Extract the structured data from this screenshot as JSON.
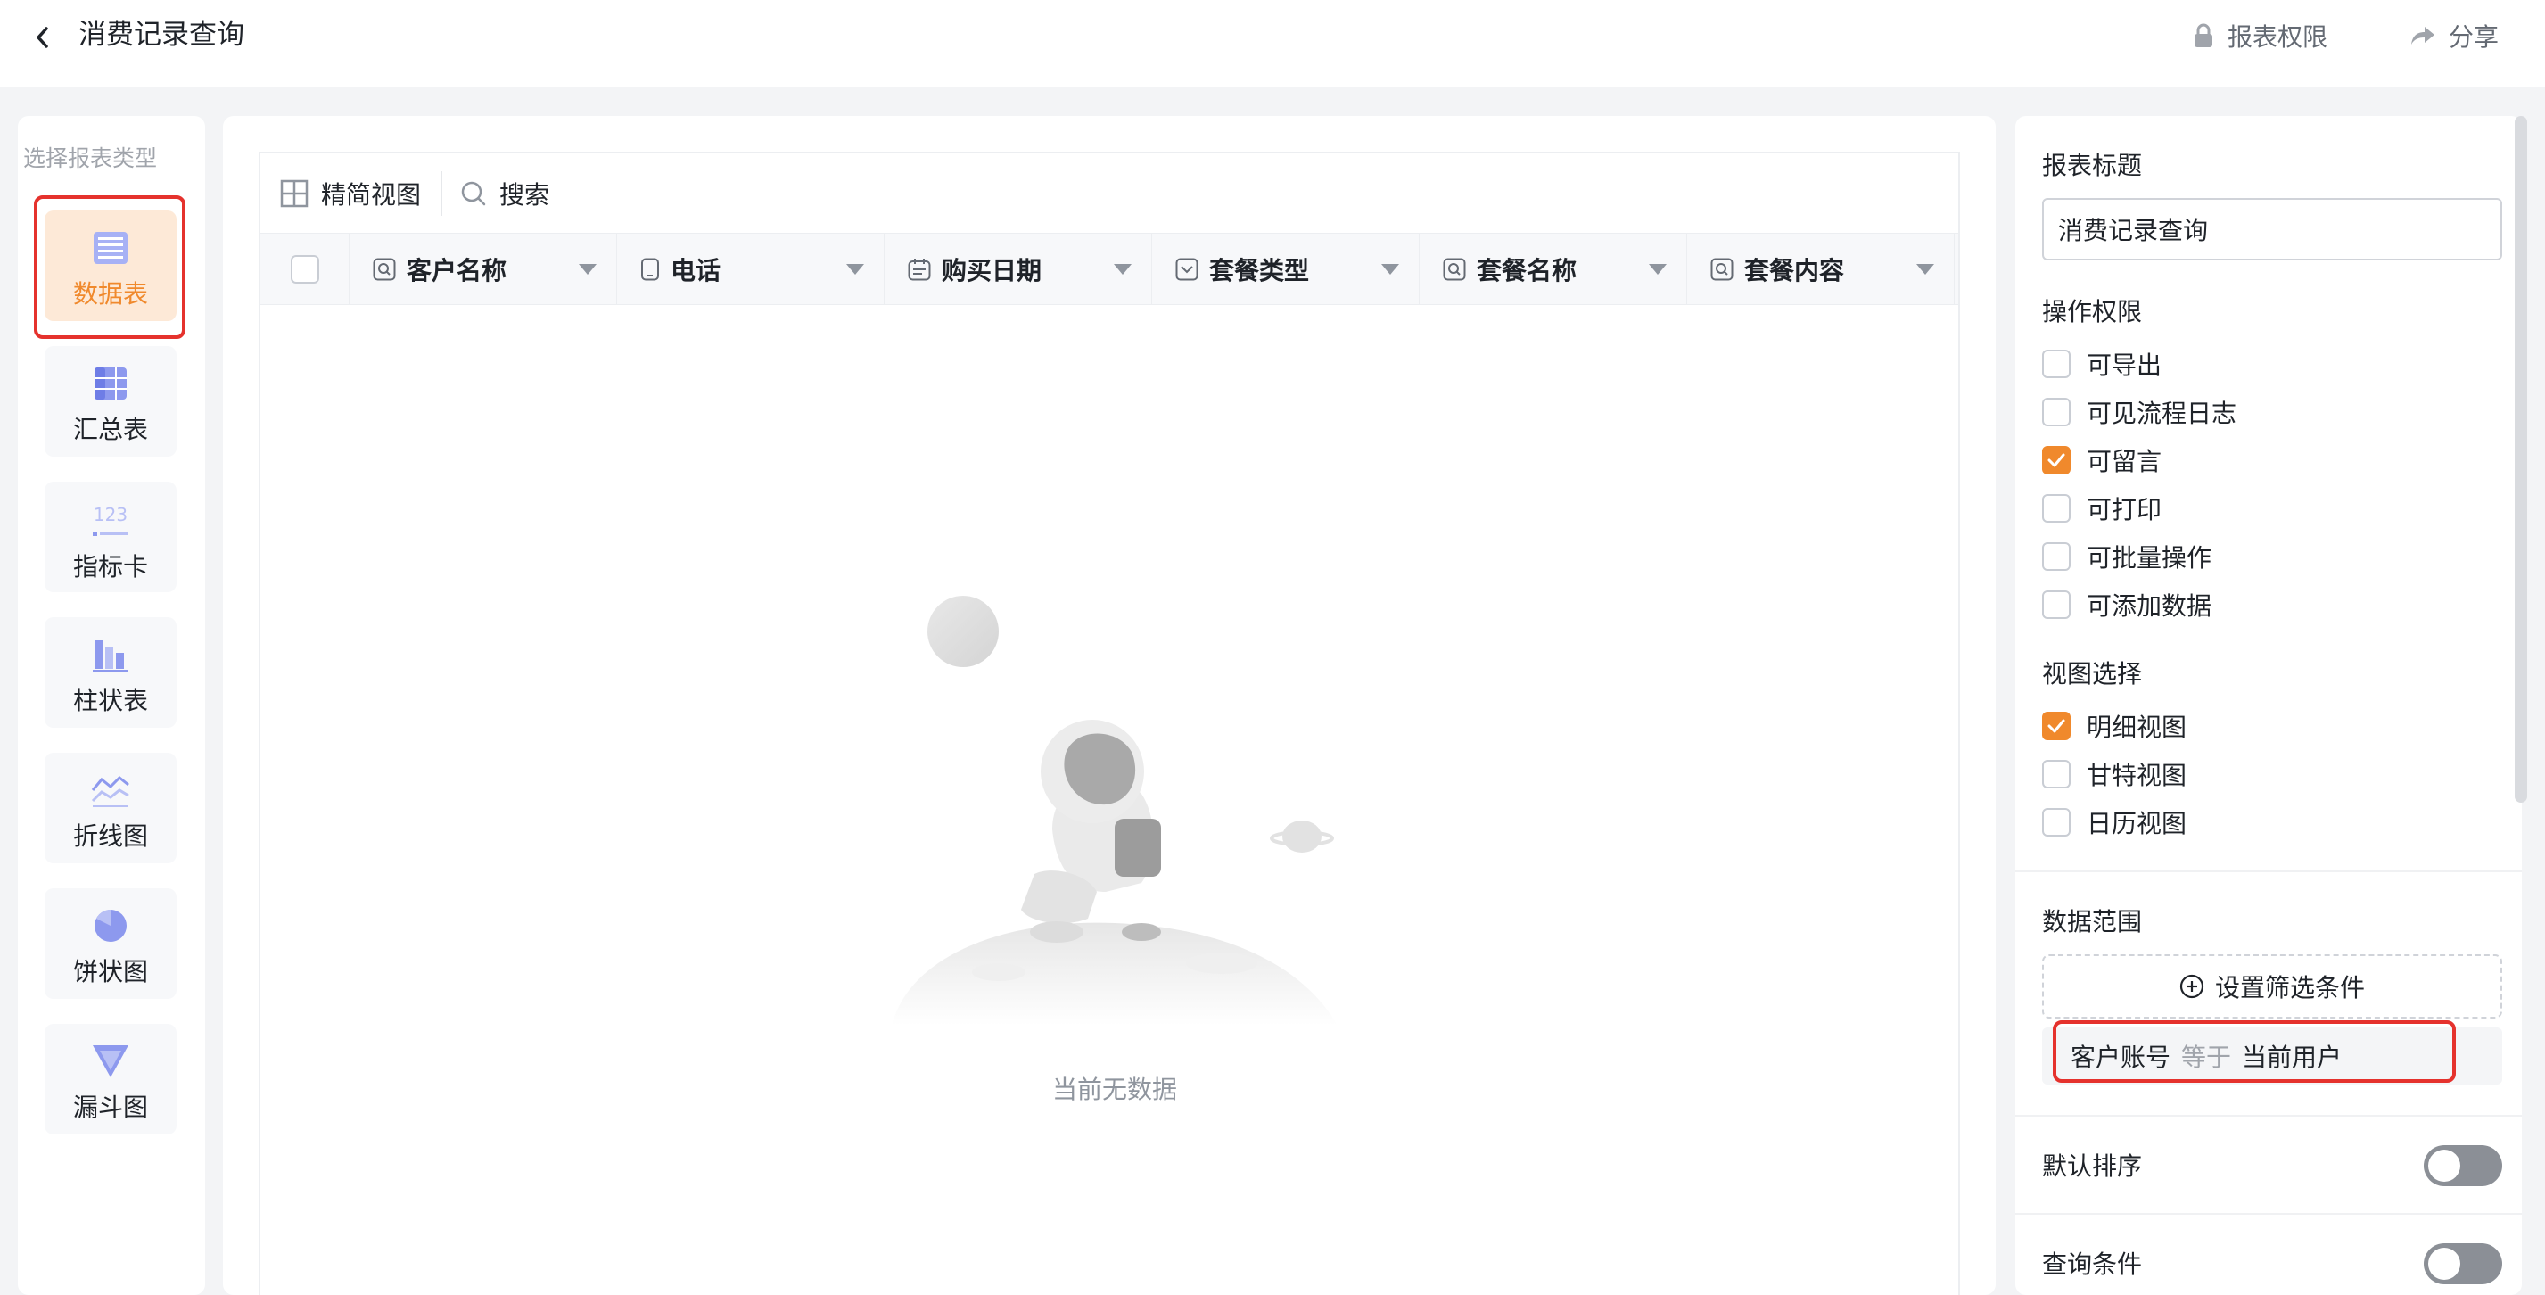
{
  "header": {
    "title": "消费记录查询",
    "report_permission": "报表权限",
    "share": "分享"
  },
  "left": {
    "label": "选择报表类型",
    "types": [
      {
        "label": "数据表",
        "icon": "table-icon",
        "active": true
      },
      {
        "label": "汇总表",
        "icon": "summary-table-icon",
        "active": false
      },
      {
        "label": "指标卡",
        "icon": "metric-card-icon",
        "active": false
      },
      {
        "label": "柱状表",
        "icon": "bar-chart-icon",
        "active": false
      },
      {
        "label": "折线图",
        "icon": "line-chart-icon",
        "active": false
      },
      {
        "label": "饼状图",
        "icon": "pie-chart-icon",
        "active": false
      },
      {
        "label": "漏斗图",
        "icon": "funnel-chart-icon",
        "active": false
      }
    ]
  },
  "table": {
    "toolbar": {
      "compact_view": "精简视图",
      "search": "搜索"
    },
    "columns": [
      {
        "label": "客户名称",
        "icon": "search-field-icon"
      },
      {
        "label": "电话",
        "icon": "phone-icon"
      },
      {
        "label": "购买日期",
        "icon": "calendar-icon"
      },
      {
        "label": "套餐类型",
        "icon": "select-icon"
      },
      {
        "label": "套餐名称",
        "icon": "search-field-icon"
      },
      {
        "label": "套餐内容",
        "icon": "search-field-icon"
      }
    ],
    "empty_text": "当前无数据"
  },
  "right": {
    "report_title_label": "报表标题",
    "report_title_value": "消费记录查询",
    "permissions_label": "操作权限",
    "permissions": [
      {
        "label": "可导出",
        "checked": false
      },
      {
        "label": "可见流程日志",
        "checked": false
      },
      {
        "label": "可留言",
        "checked": true
      },
      {
        "label": "可打印",
        "checked": false
      },
      {
        "label": "可批量操作",
        "checked": false
      },
      {
        "label": "可添加数据",
        "checked": false
      }
    ],
    "views_label": "视图选择",
    "views": [
      {
        "label": "明细视图",
        "checked": true
      },
      {
        "label": "甘特视图",
        "checked": false
      },
      {
        "label": "日历视图",
        "checked": false
      }
    ],
    "data_scope_label": "数据范围",
    "filter_button": "设置筛选条件",
    "condition": {
      "field": "客户账号",
      "operator": "等于",
      "value": "当前用户"
    },
    "default_sort_label": "默认排序",
    "default_sort_on": false,
    "query_conditions_label": "查询条件",
    "query_conditions_on": false
  },
  "colors": {
    "accent": "#f0892c",
    "highlight_outline": "#e5322d",
    "toggle_off": "#8b8f96"
  }
}
